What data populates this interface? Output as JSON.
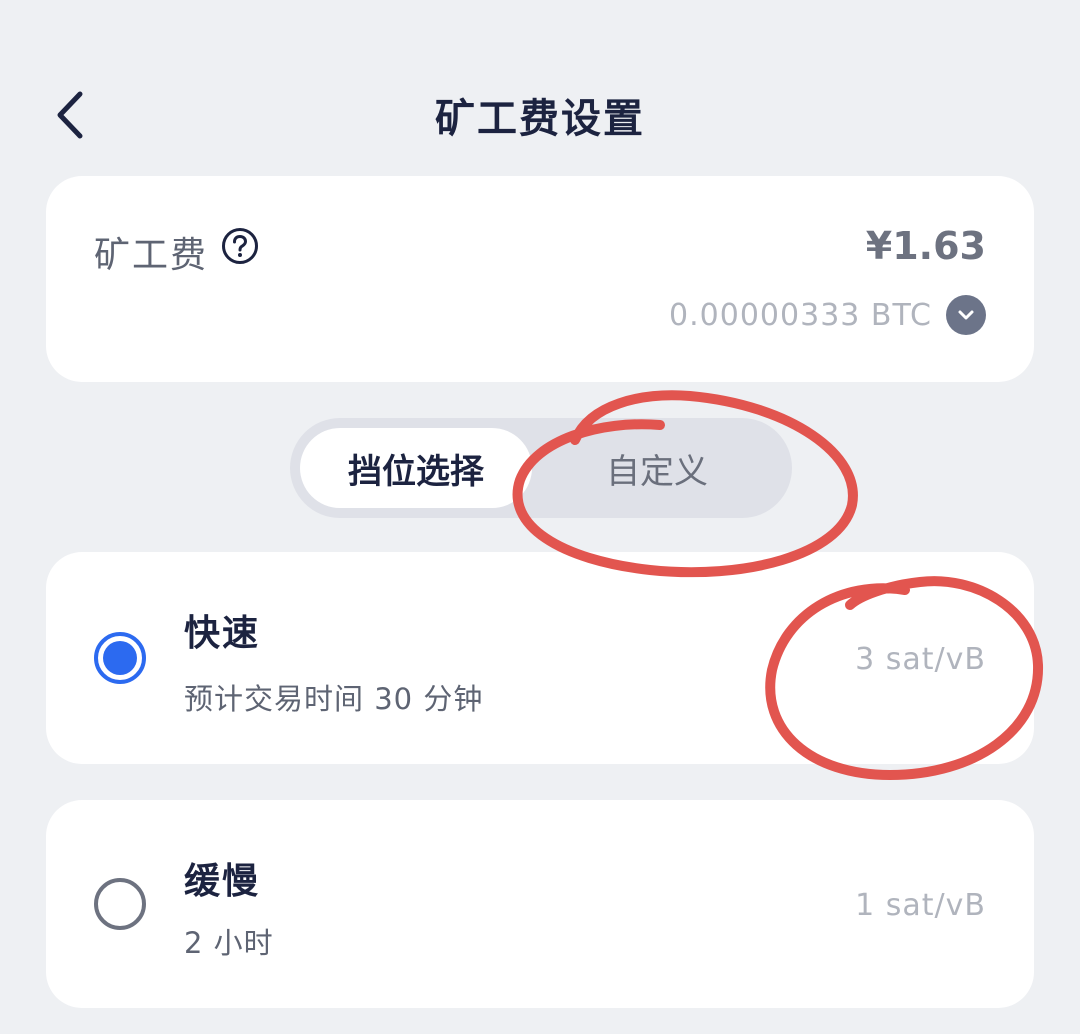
{
  "header": {
    "title": "矿工费设置",
    "back_icon": "chevron-left-icon"
  },
  "fee": {
    "label": "矿工费",
    "help_icon": "question-circle-icon",
    "amount": "¥1.63",
    "btc_amount": "0.00000333 BTC",
    "toggle_icon": "chevron-down-icon"
  },
  "tabs": [
    {
      "label": "挡位选择",
      "active": true
    },
    {
      "label": "自定义",
      "active": false
    }
  ],
  "options": [
    {
      "name": "快速",
      "time": "预计交易时间 30 分钟",
      "rate": "3 sat/vB",
      "selected": true
    },
    {
      "name": "缓慢",
      "time": "2 小时",
      "rate": "1 sat/vB",
      "selected": false
    }
  ],
  "colors": {
    "background": "#eef0f3",
    "card": "#ffffff",
    "accent": "#2c6af0",
    "annotation": "#e2554f"
  }
}
